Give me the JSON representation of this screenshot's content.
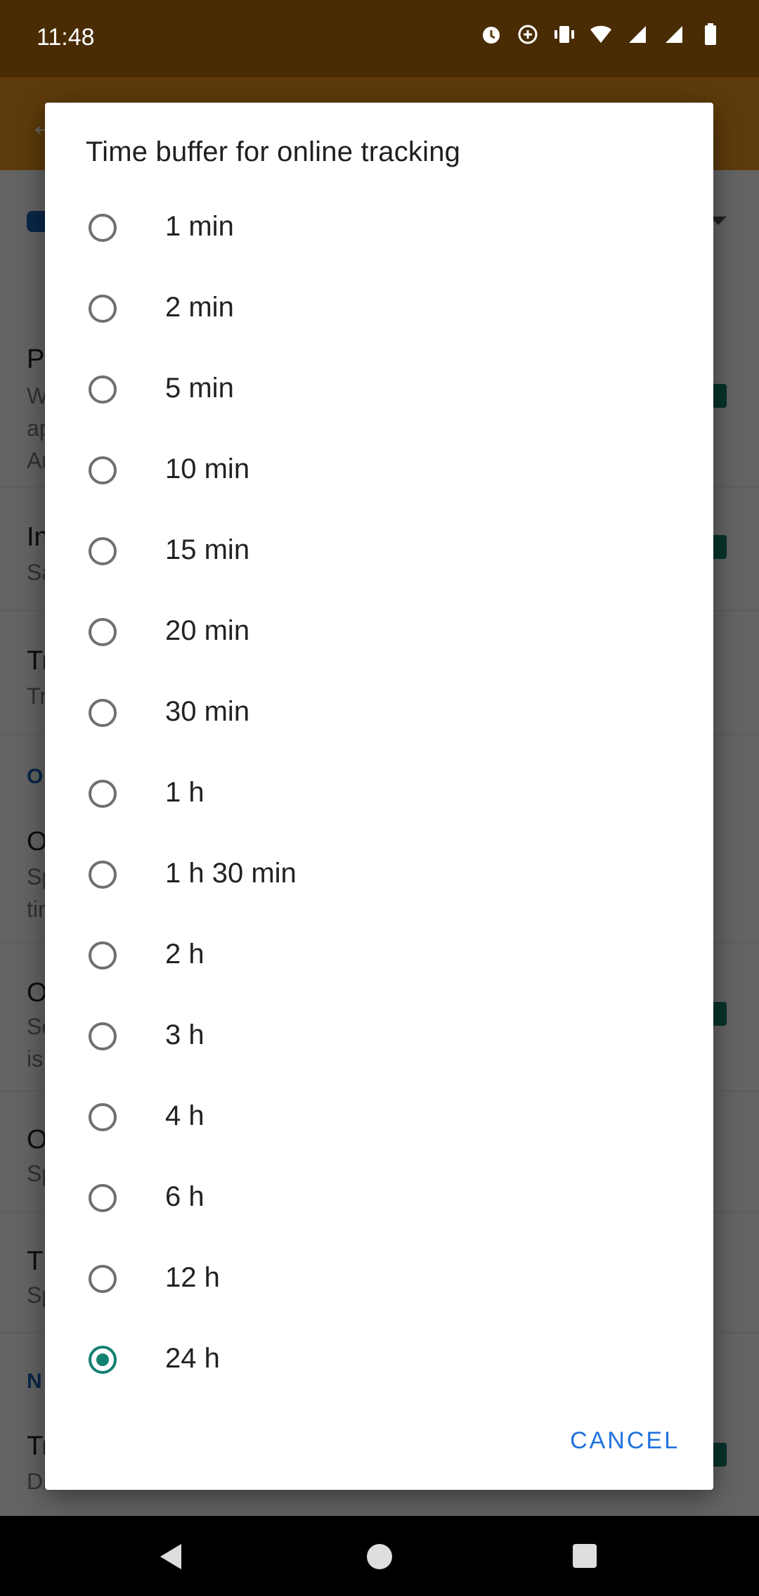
{
  "status_bar": {
    "time": "11:48",
    "icons": [
      "alarm-icon",
      "data-saver-icon",
      "vibrate-icon",
      "wifi-icon",
      "signal-icon",
      "signal-icon",
      "battery-icon"
    ]
  },
  "background": {
    "section_labels": [
      "O",
      "N"
    ]
  },
  "dialog": {
    "title": "Time buffer for online tracking",
    "options": [
      {
        "label": "1 min",
        "selected": false
      },
      {
        "label": "2 min",
        "selected": false
      },
      {
        "label": "5 min",
        "selected": false
      },
      {
        "label": "10 min",
        "selected": false
      },
      {
        "label": "15 min",
        "selected": false
      },
      {
        "label": "20 min",
        "selected": false
      },
      {
        "label": "30 min",
        "selected": false
      },
      {
        "label": "1 h",
        "selected": false
      },
      {
        "label": "1 h 30 min",
        "selected": false
      },
      {
        "label": "2 h",
        "selected": false
      },
      {
        "label": "3 h",
        "selected": false
      },
      {
        "label": "4 h",
        "selected": false
      },
      {
        "label": "6 h",
        "selected": false
      },
      {
        "label": "12 h",
        "selected": false
      },
      {
        "label": "24 h",
        "selected": true
      }
    ],
    "cancel_label": "CANCEL"
  },
  "colors": {
    "accent": "#13816f",
    "button_text": "#1f72de",
    "toolbar": "#ec9419",
    "section_header": "#1b5fb5"
  },
  "nav_bar": {
    "buttons": [
      "back-icon",
      "home-icon",
      "recents-icon"
    ]
  }
}
